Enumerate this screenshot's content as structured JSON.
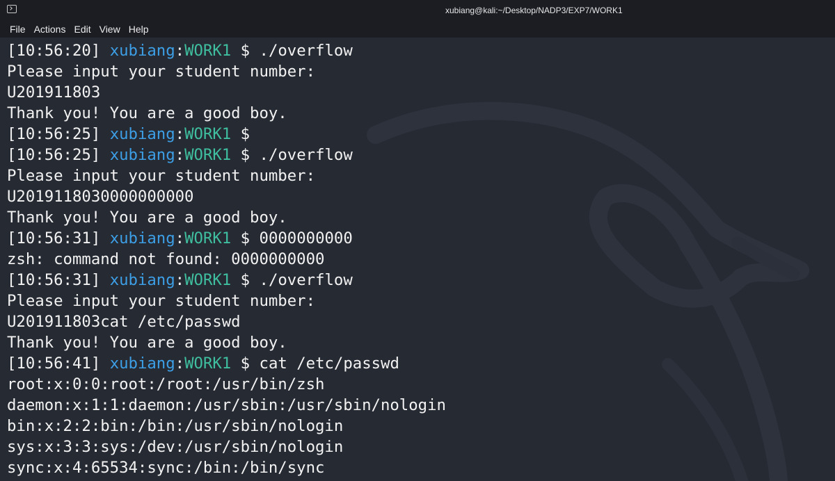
{
  "window": {
    "title": "xubiang@kali:~/Desktop/NADP3/EXP7/WORK1",
    "icon": "terminal-icon"
  },
  "menu": [
    {
      "label": "File"
    },
    {
      "label": "Actions"
    },
    {
      "label": "Edit"
    },
    {
      "label": "View"
    },
    {
      "label": "Help"
    }
  ],
  "colors": {
    "background": "#262a33",
    "user": "#3d9fe6",
    "directory": "#3fbf9f",
    "text": "#f2f2f2"
  },
  "terminal": {
    "lines": [
      {
        "type": "prompt",
        "time": "[10:56:20]",
        "user": "xubiang",
        "dir": "WORK1",
        "symbol": "$",
        "command": "./overflow"
      },
      {
        "type": "output",
        "text": "Please input your student number:"
      },
      {
        "type": "output",
        "text": "U201911803"
      },
      {
        "type": "output",
        "text": "Thank you! You are a good boy."
      },
      {
        "type": "prompt",
        "time": "[10:56:25]",
        "user": "xubiang",
        "dir": "WORK1",
        "symbol": "$",
        "command": ""
      },
      {
        "type": "prompt",
        "time": "[10:56:25]",
        "user": "xubiang",
        "dir": "WORK1",
        "symbol": "$",
        "command": "./overflow"
      },
      {
        "type": "output",
        "text": "Please input your student number:"
      },
      {
        "type": "output",
        "text": "U2019118030000000000"
      },
      {
        "type": "output",
        "text": "Thank you! You are a good boy."
      },
      {
        "type": "prompt",
        "time": "[10:56:31]",
        "user": "xubiang",
        "dir": "WORK1",
        "symbol": "$",
        "command": "0000000000"
      },
      {
        "type": "output",
        "text": "zsh: command not found: 0000000000"
      },
      {
        "type": "prompt",
        "time": "[10:56:31]",
        "user": "xubiang",
        "dir": "WORK1",
        "symbol": "$",
        "command": "./overflow"
      },
      {
        "type": "output",
        "text": "Please input your student number:"
      },
      {
        "type": "output",
        "text": "U201911803cat /etc/passwd"
      },
      {
        "type": "output",
        "text": "Thank you! You are a good boy."
      },
      {
        "type": "prompt",
        "time": "[10:56:41]",
        "user": "xubiang",
        "dir": "WORK1",
        "symbol": "$",
        "command": "cat /etc/passwd"
      },
      {
        "type": "output",
        "text": "root:x:0:0:root:/root:/usr/bin/zsh"
      },
      {
        "type": "output",
        "text": "daemon:x:1:1:daemon:/usr/sbin:/usr/sbin/nologin"
      },
      {
        "type": "output",
        "text": "bin:x:2:2:bin:/bin:/usr/sbin/nologin"
      },
      {
        "type": "output",
        "text": "sys:x:3:3:sys:/dev:/usr/sbin/nologin"
      },
      {
        "type": "output",
        "text": "sync:x:4:65534:sync:/bin:/bin/sync"
      }
    ]
  }
}
